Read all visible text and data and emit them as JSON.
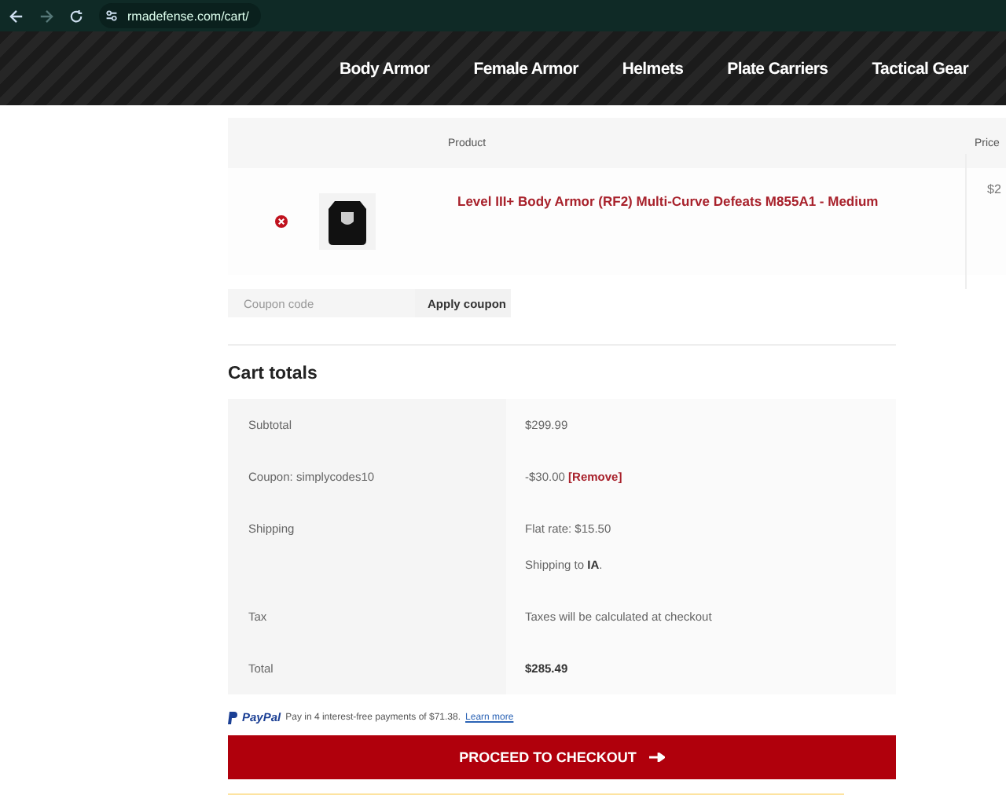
{
  "browser": {
    "url": "rmadefense.com/cart/"
  },
  "nav": {
    "items": [
      {
        "label": "Body Armor"
      },
      {
        "label": "Female Armor"
      },
      {
        "label": "Helmets"
      },
      {
        "label": "Plate Carriers"
      },
      {
        "label": "Tactical Gear"
      }
    ]
  },
  "cart_table": {
    "columns": [
      "Product",
      "Price"
    ],
    "rows": [
      {
        "product": "Level III+ Body Armor (RF2) Multi-Curve Defeats M855A1 - Medium",
        "price": "$2"
      }
    ]
  },
  "coupon": {
    "placeholder": "Coupon code",
    "button": "Apply coupon"
  },
  "cart_totals": {
    "title": "Cart totals",
    "rows": [
      {
        "label": "Subtotal",
        "lines": [
          "$299.99"
        ]
      },
      {
        "label": "Coupon: simplycodes10",
        "lines": [
          "-$30.00"
        ],
        "link": "[Remove]"
      },
      {
        "label": "Shipping",
        "lines": [
          "Flat rate: $15.50",
          "Shipping to **IA**."
        ]
      },
      {
        "label": "Tax",
        "lines": [
          "Taxes will be calculated at checkout"
        ]
      },
      {
        "label": "Total",
        "lines": [
          "**$285.49**"
        ]
      }
    ]
  },
  "paypal": {
    "logo": "PayPal",
    "message": "Pay in 4 interest-free payments of $71.38.",
    "link": "Learn more"
  },
  "checkout_button": "PROCEED TO CHECKOUT"
}
